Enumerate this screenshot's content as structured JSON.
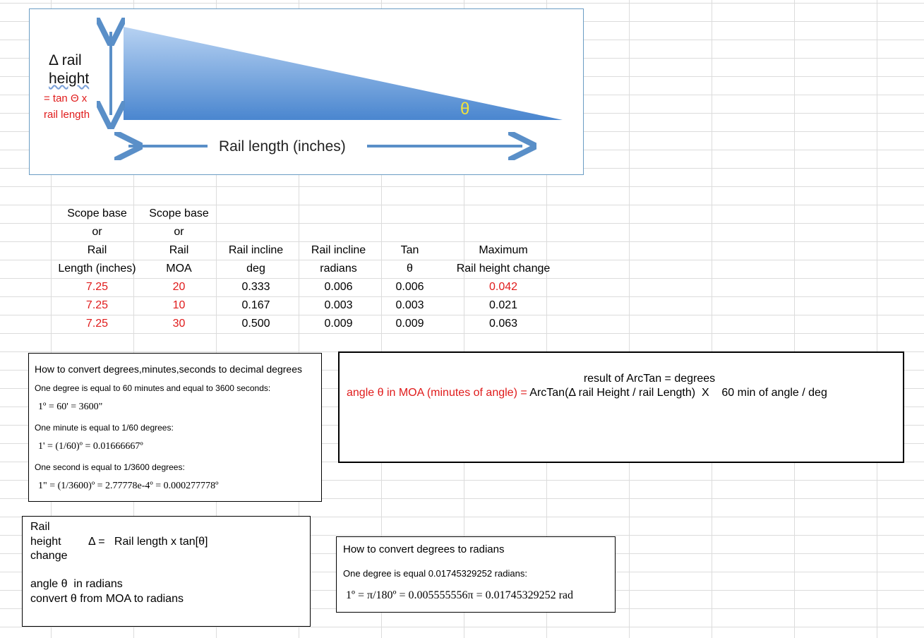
{
  "diagram": {
    "delta_label_line1": "Δ rail",
    "delta_label_line2": "height",
    "tan_label_line1": "= tan Θ  x",
    "tan_label_line2": "rail length",
    "theta_label": "θ",
    "rail_length_label": "Rail length (inches)",
    "colors": {
      "triangle_top": "#b7d2f2",
      "triangle_bottom": "#4a86cf",
      "arrow": "#5a8fc8",
      "red_text": "#e01b1b",
      "theta": "#f2e23a"
    }
  },
  "table": {
    "headers": [
      [
        "Scope base",
        "Scope base",
        "",
        "",
        "",
        ""
      ],
      [
        "or",
        "or",
        "",
        "",
        "",
        ""
      ],
      [
        "Rail",
        "Rail",
        "Rail incline",
        "Rail incline",
        "Tan",
        "Maximum"
      ],
      [
        "Length (inches)",
        "MOA",
        "deg",
        "radians",
        "θ",
        "Rail height change"
      ]
    ],
    "rows": [
      [
        "7.25",
        "20",
        "0.333",
        "0.006",
        "0.006",
        "0.042"
      ],
      [
        "7.25",
        "10",
        "0.167",
        "0.003",
        "0.003",
        "0.021"
      ],
      [
        "7.25",
        "30",
        "0.500",
        "0.009",
        "0.009",
        "0.063"
      ]
    ]
  },
  "dms_box": {
    "title": "How to convert degrees,minutes,seconds to decimal degrees",
    "line1": "One degree is equal to 60 minutes and equal to 3600 seconds:",
    "formula1": "1º = 60' = 3600\"",
    "line2": "One minute is equal to 1/60 degrees:",
    "formula2": "1' = (1/60)º = 0.01666667º",
    "line3": "One second is equal to 1/3600 degrees:",
    "formula3": "1\" = (1/3600)º = 2.77778e-4º = 0.000277778º"
  },
  "moa_box": {
    "line1": "result of ArcTan = degrees",
    "line2_red": "angle θ in MOA (minutes of angle) = ",
    "line2_black": "ArcTan(Δ rail Height / rail Length)  X    60 min of angle / deg"
  },
  "rail_box": {
    "l1": "Rail",
    "l2a": "height",
    "l2b": "Δ =   Rail length x tan[θ]",
    "l3": "change",
    "l4": "angle θ  in radians",
    "l5": "convert θ from MOA to radians"
  },
  "rad_box": {
    "title": "How to convert degrees to radians",
    "line1": "One degree is equal 0.01745329252 radians:",
    "formula": "1º = π/180º = 0.005555556π = 0.01745329252 rad"
  }
}
